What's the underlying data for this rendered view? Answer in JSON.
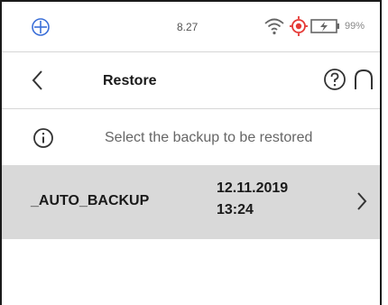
{
  "status_bar": {
    "time": "8.27",
    "battery_percent": "99%",
    "icons": [
      "target-icon",
      "wifi-icon",
      "alarm-icon",
      "battery-charging-icon"
    ]
  },
  "header": {
    "title": "Restore",
    "icons": [
      "back-chevron-icon",
      "help-icon",
      "home-icon"
    ]
  },
  "info": {
    "text": "Select the backup to be restored",
    "icon": "info-icon"
  },
  "backups": [
    {
      "name": "_AUTO_BACKUP",
      "date": "12.11.2019",
      "time": "13:24"
    }
  ],
  "colors": {
    "selected_row_bg": "#d9d9d9",
    "alarm_red": "#e53935",
    "divider": "#d6d6d6"
  }
}
